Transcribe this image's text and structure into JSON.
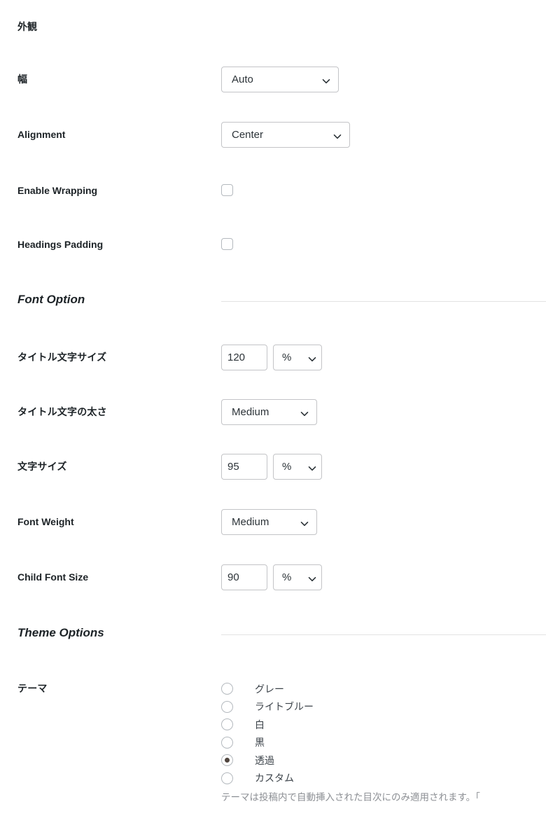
{
  "appearance_section": {
    "heading": "外観",
    "rows": [
      {
        "label": "幅",
        "control": "select",
        "value": "Auto"
      },
      {
        "label": "Alignment",
        "control": "select",
        "value": "Center"
      },
      {
        "label": "Enable Wrapping",
        "control": "checkbox",
        "checked": false
      },
      {
        "label": "Headings Padding",
        "control": "checkbox",
        "checked": false
      }
    ]
  },
  "font_option_section": {
    "title": "Font Option",
    "rows": [
      {
        "label": "タイトル文字サイズ",
        "control": "number-unit",
        "value": "120",
        "unit": "%"
      },
      {
        "label": "タイトル文字の太さ",
        "control": "select",
        "value": "Medium"
      },
      {
        "label": "文字サイズ",
        "control": "number-unit",
        "value": "95",
        "unit": "%"
      },
      {
        "label": "Font Weight",
        "control": "select",
        "value": "Medium"
      },
      {
        "label": "Child Font Size",
        "control": "number-unit",
        "value": "90",
        "unit": "%"
      }
    ]
  },
  "theme_options_section": {
    "title": "Theme Options",
    "theme_row": {
      "label": "テーマ",
      "options": [
        {
          "label": "グレー",
          "selected": false
        },
        {
          "label": "ライトブルー",
          "selected": false
        },
        {
          "label": "白",
          "selected": false
        },
        {
          "label": "黒",
          "selected": false
        },
        {
          "label": "透過",
          "selected": true
        },
        {
          "label": "カスタム",
          "selected": false
        }
      ],
      "help_text": "テーマは投稿内で自動挿入された目次にのみ適用されます。「"
    }
  },
  "colors": {
    "text": "#1d2327",
    "muted_text": "#8c8f94",
    "border": "#c3c4c7",
    "rule": "#e3e3e3",
    "radio_dot": "#50453e",
    "background": "#ffffff"
  }
}
